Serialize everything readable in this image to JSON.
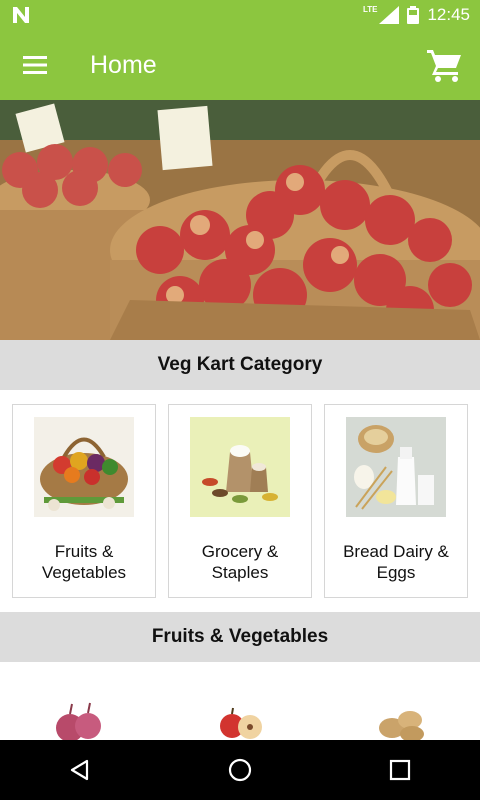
{
  "status_bar": {
    "network": "LTE",
    "time": "12:45",
    "notification_icon": "n-letter-icon",
    "signal_icon": "signal-icon",
    "battery_icon": "battery-icon"
  },
  "app_bar": {
    "title": "Home",
    "menu_icon": "menu-icon",
    "cart_icon": "cart-icon",
    "color": "#8cc63f"
  },
  "banner": {
    "image": "apple-baskets-photo"
  },
  "category_section": {
    "title": "Veg Kart Category",
    "items": [
      {
        "line1": "Fruits &",
        "line2": "Vegetables",
        "image": "fruits-vegetables-photo"
      },
      {
        "line1": "Grocery &",
        "line2": "Staples",
        "image": "grocery-staples-photo"
      },
      {
        "line1": "Bread Dairy &",
        "line2": "Eggs",
        "image": "bread-dairy-eggs-photo"
      }
    ]
  },
  "fruits_section": {
    "title": "Fruits & Vegetables",
    "products": [
      {
        "image": "onions-photo"
      },
      {
        "image": "apples-photo"
      },
      {
        "image": "potatoes-photo"
      }
    ]
  },
  "nav_bar": {
    "back_icon": "back-icon",
    "home_icon": "home-icon",
    "recents_icon": "recents-icon"
  }
}
